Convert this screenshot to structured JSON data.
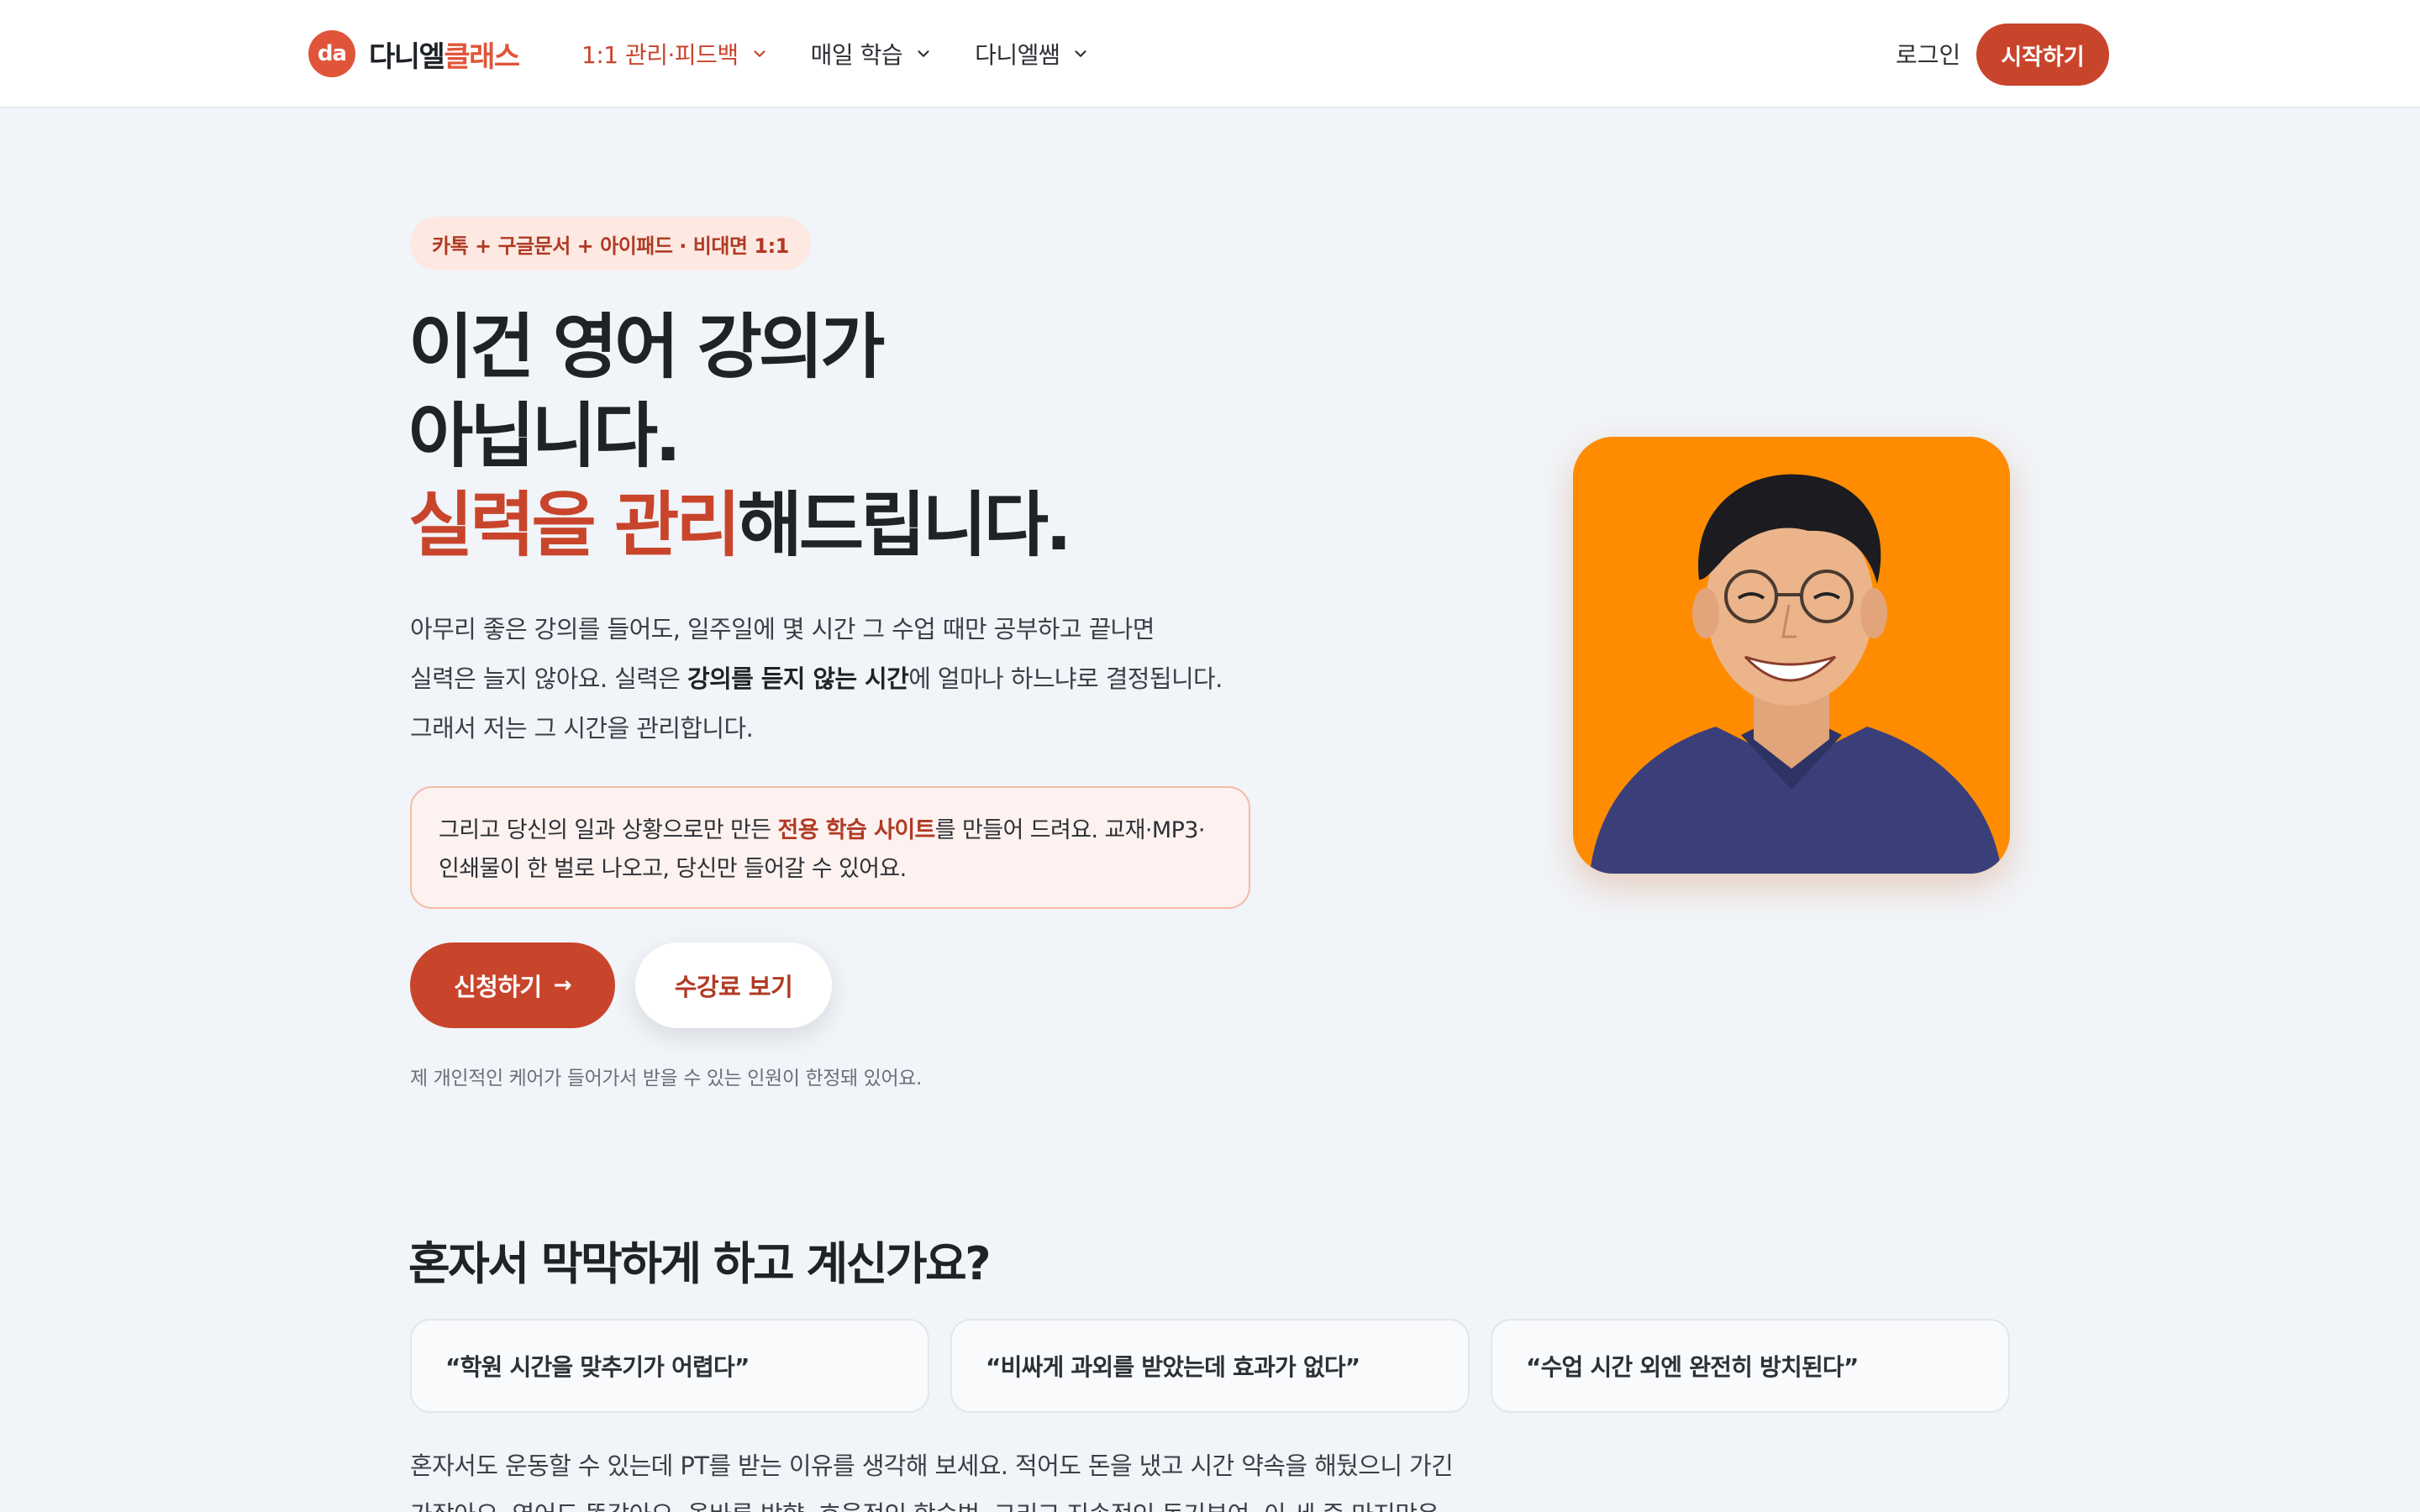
{
  "header": {
    "logo_mark": "da",
    "logo_name_main": "다니엘",
    "logo_name_accent": "클래스",
    "nav": [
      {
        "label": "1:1 관리·피드백",
        "active": true
      },
      {
        "label": "매일 학습",
        "active": false
      },
      {
        "label": "다니엘쌤",
        "active": false
      }
    ],
    "login_label": "로그인",
    "start_label": "시작하기"
  },
  "hero": {
    "badge": "카톡 + 구글문서 + 아이패드 · 비대면 1:1",
    "title_line1": "이건 영어 강의가",
    "title_line2": "아닙니다.",
    "title_line3_highlight": "실력을 관리",
    "title_line3_rest": "해드립니다.",
    "desc_line1": "아무리 좋은 강의를 들어도, 일주일에 몇 시간 그 수업 때만 공부하고 끝나면",
    "desc_line2_a": "실력은 늘지 않아요. 실력은 ",
    "desc_line2_bold": "강의를 듣지 않는 시간",
    "desc_line2_b": "에 얼마나 하느냐로 결정됩니다.",
    "desc_line3": "그래서 저는 그 시간을 관리합니다.",
    "note_a": "그리고 당신의 일과 상황으로만 만든 ",
    "note_bold": "전용 학습 사이트",
    "note_b": "를 만들어 드려요. 교재·MP3·",
    "note_line2": "인쇄물이 한 벌로 나오고, 당신만 들어갈 수 있어요.",
    "apply_label": "신청하기",
    "apply_arrow": "→",
    "fee_label": "수강료 보기",
    "small_note": "제 개인적인 케어가 들어가서 받을 수 있는 인원이 한정돼 있어요."
  },
  "section2": {
    "title": "혼자서 막막하게 하고 계신가요?",
    "quotes": [
      "“학원 시간을 맞추기가 어렵다”",
      "“비싸게 과외를 받았는데 효과가 없다”",
      "“수업 시간 외엔 완전히 방치된다”"
    ],
    "body_line1": "혼자서도 운동할 수 있는데 PT를 받는 이유를 생각해 보세요. 적어도 돈을 냈고 시간 약속을 해뒀으니 가긴",
    "body_line2": "가잖아요. 영어도 똑같아요. 올바른 방향, 효율적인 학습법, 그리고 지속적인 동기부여. 이 세 중 마지막은"
  },
  "colors": {
    "accent": "#c8452c",
    "logo": "#e0553a",
    "portrait_bg": "#ff8c00",
    "page_bg": "#f1f4f8"
  }
}
